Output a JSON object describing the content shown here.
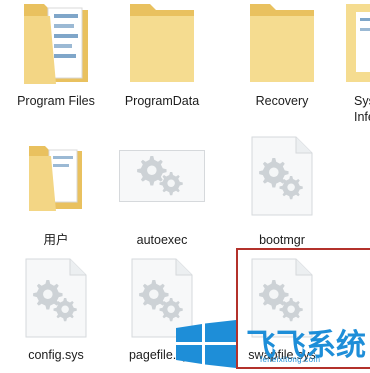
{
  "files": [
    {
      "label": "Program Files",
      "kind": "folder"
    },
    {
      "label": "ProgramData",
      "kind": "folder"
    },
    {
      "label": "Recovery",
      "kind": "folder"
    },
    {
      "label": "Sys",
      "label2": "Infe",
      "kind": "folder"
    },
    {
      "label": "用户",
      "kind": "folder"
    },
    {
      "label": "autoexec",
      "kind": "file-flat"
    },
    {
      "label": "bootmgr",
      "kind": "file"
    },
    {
      "label": "config.sys",
      "kind": "file"
    },
    {
      "label": "pagefile.sys",
      "kind": "file"
    },
    {
      "label": "swapfile.sys",
      "kind": "file",
      "selected": true
    }
  ],
  "watermark": {
    "text": "飞飞系统",
    "url": "feifeixitong.com",
    "brand_color": "#1e8ed8"
  },
  "colors": {
    "selection_border": "#b3312b",
    "folder_yellow": "#f2d27a",
    "gear_gray": "#c9ced3"
  }
}
